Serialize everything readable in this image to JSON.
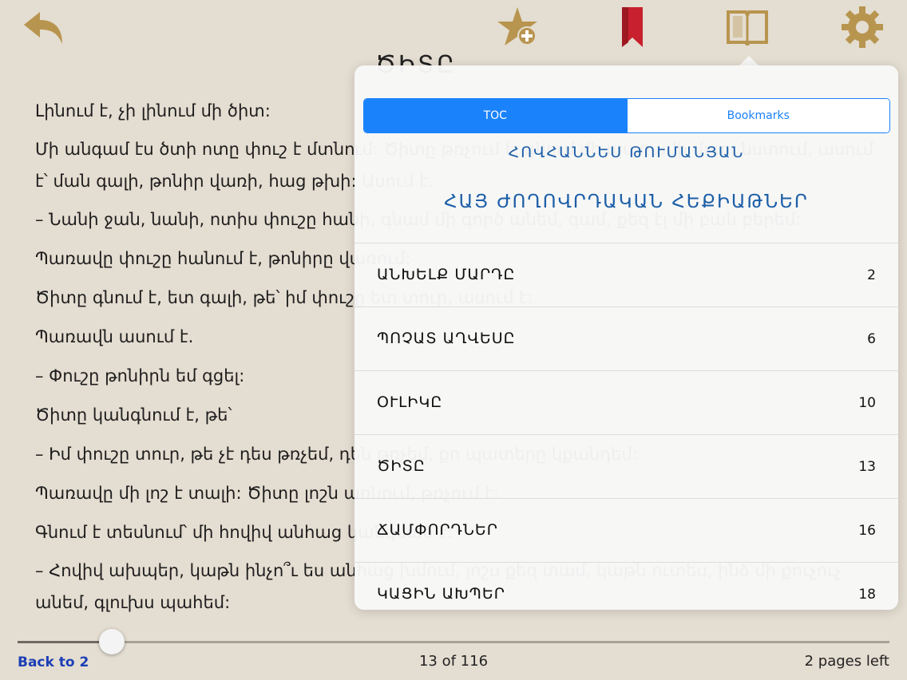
{
  "toolbar": {
    "back_icon": "back-arrow-icon",
    "favorite_icon": "star-add-icon",
    "bookmark_icon": "bookmark-ribbon-icon",
    "toc_icon": "open-book-icon",
    "settings_icon": "gear-icon",
    "colors": {
      "gold": "#b8954f",
      "red": "#c8202e"
    }
  },
  "chapter_title": "ԾԻՏԸ",
  "book_text": [
    "Լինում է, չի լինում մի ծիտ:",
    "Մի անգամ էս ծտի ոտը փուշ է մտնում: Ծիտը թռչում է, գնում մի պառավի մոտ, նստում, ասում է՝ ման գալի, թոնիր վառի, հաց թխի: Ասում է.",
    "– Նանի ջան, նանի, ոտիս փուշը հանի, գնամ մի գործ անեմ, գամ, քեզ էլ մի բան բերեմ:",
    "Պառավը փուշը հանում է, թոնիրը վառում:",
    "Ծիտը գնում է, ետ գալի, թե՝ իմ փուշը ետ տուր, ասում է:",
    "Պառավն ասում է.",
    "– Փուշը թոնիրն եմ գցել:",
    "Ծիտը կանգնում է, թե՝",
    "– Իմ փուշը տուր, թե չէ դես թռչեմ, դեն թռչեմ, քո պատերը կքանդեմ:",
    "Պառավը մի լոշ է տալի: Ծիտը լոշն առնում, թռչում է:",
    "Գնում է տեսնում՝ մի հովիվ անհաց կանգնած է:",
    "– Հովիվ ախպեր, կաթն ինչո՞ւ ես անհաց խմում, լոշս քեզ տամ, կաթն ուտես, ինձ մի քուչուչ անեմ, գլուխս պահեմ:"
  ],
  "footer": {
    "back_link": "Back to 2",
    "page_indicator": "13 of 116",
    "pages_left": "2 pages left",
    "progress": 0.1
  },
  "popover": {
    "tabs": [
      "TOC",
      "Bookmarks"
    ],
    "active_tab": "TOC",
    "author": "ՀՈՎՀԱՆՆԵՍ ԹՈՒՄԱՆՅԱՆ",
    "book_title": "ՀԱՅ ԺՈՂՈՎՐԴԱԿԱՆ ՀԵՔԻԱԹՆԵՐ",
    "toc": [
      {
        "title": "ԱՆԽԵԼՔ ՄԱՐԴԸ",
        "page": "2"
      },
      {
        "title": "ՊՈՉԱՏ ԱՂՎԵՍԸ",
        "page": "6"
      },
      {
        "title": "ՕՒԼԻԿԸ",
        "page": "10"
      },
      {
        "title": "ԾԻՏԸ",
        "page": "13"
      },
      {
        "title": "ՃԱՄՓՈՐԴՆԵՐ",
        "page": "16"
      },
      {
        "title": "ԿԱՑԻՆ ԱԽՊԵՐ",
        "page": "18"
      }
    ]
  }
}
